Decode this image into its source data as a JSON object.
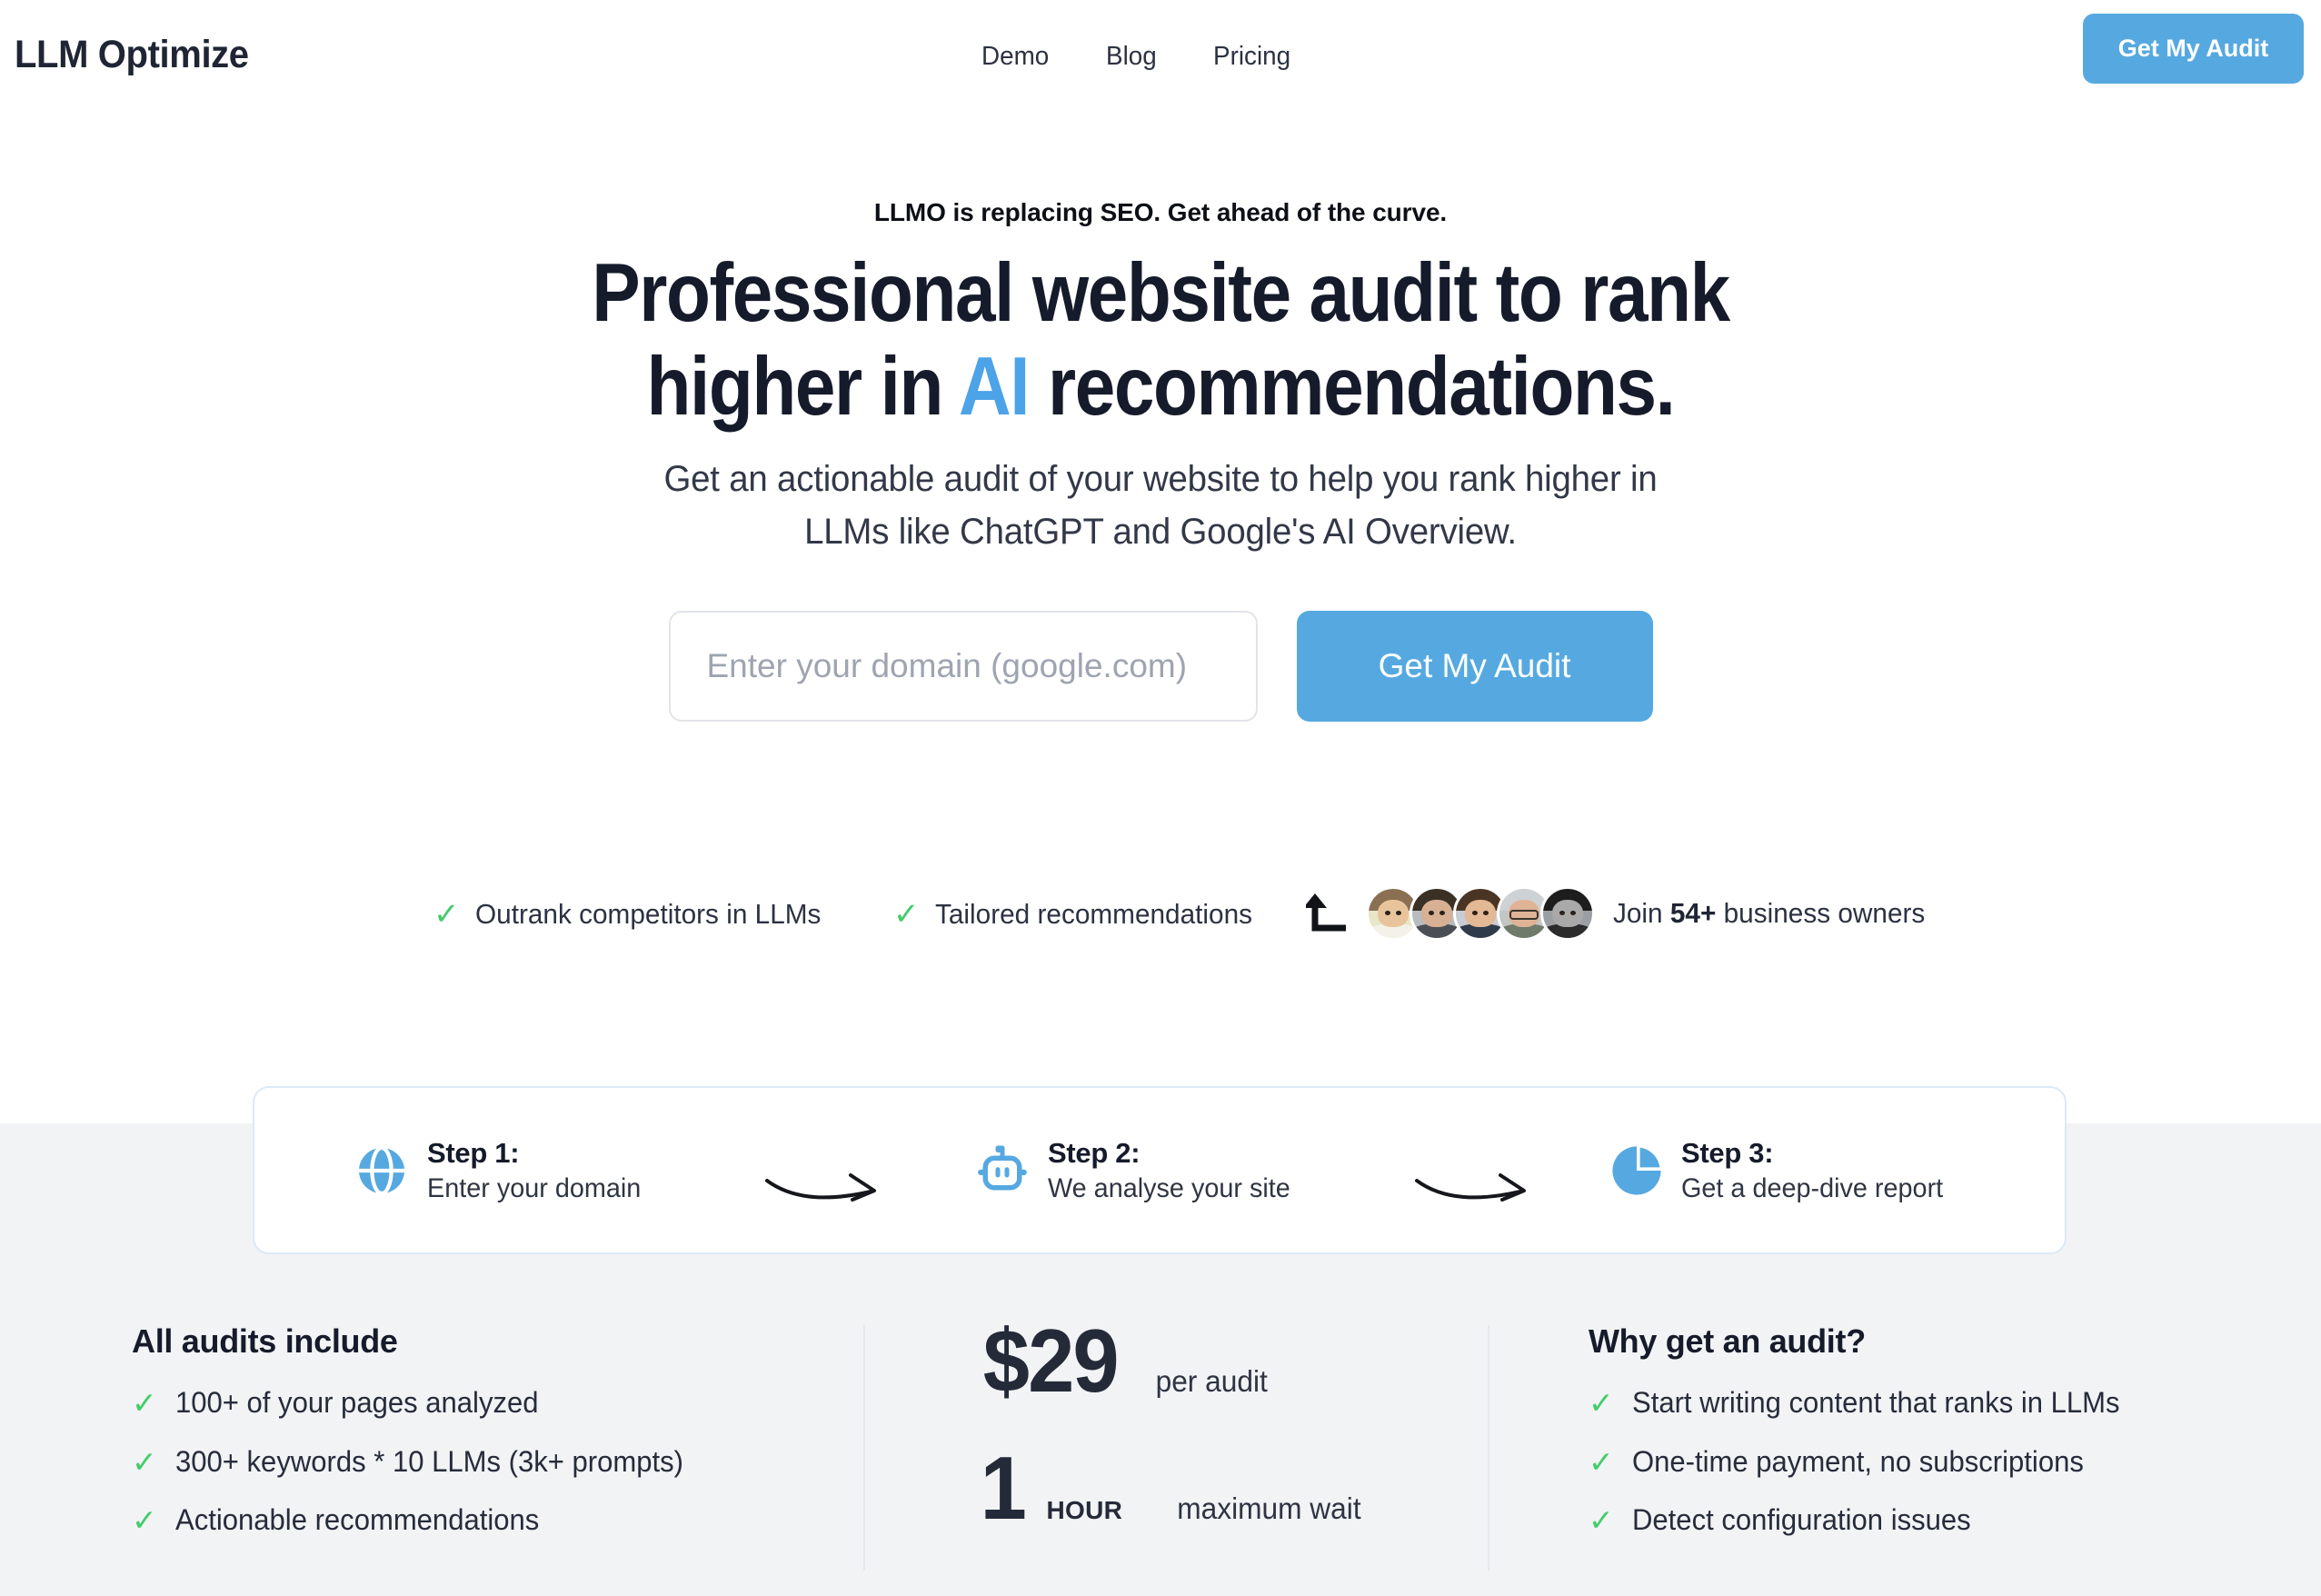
{
  "header": {
    "logo": "LLM Optimize",
    "nav": [
      {
        "label": "Demo"
      },
      {
        "label": "Blog"
      },
      {
        "label": "Pricing"
      }
    ],
    "cta_label": "Get My Audit"
  },
  "hero": {
    "eyebrow": "LLMO is replacing SEO. Get ahead of the curve.",
    "headline_line1": "Professional website audit to rank",
    "headline_line2_before": "higher in ",
    "headline_highlight": "AI",
    "headline_line2_after": " recommendations.",
    "subhead_line1": "Get an actionable audit of your website to help you rank higher in",
    "subhead_line2": "LLMs like ChatGPT and Google's AI Overview.",
    "input_placeholder": "Enter your domain (google.com)",
    "input_value": "",
    "cta_label": "Get My Audit",
    "features": [
      {
        "label": "Outrank competitors in LLMs"
      },
      {
        "label": "Tailored recommendations"
      }
    ],
    "social_proof": {
      "prefix": "Join ",
      "count": "54+",
      "suffix": " business owners",
      "avatar_count": 5
    }
  },
  "steps": [
    {
      "icon": "globe-icon",
      "title": "Step 1:",
      "desc": "Enter your domain"
    },
    {
      "icon": "robot-icon",
      "title": "Step 2:",
      "desc": "We analyse your site"
    },
    {
      "icon": "pie-chart-icon",
      "title": "Step 3:",
      "desc": "Get a deep-dive report"
    }
  ],
  "audits": {
    "title": "All audits include",
    "items": [
      {
        "label": "100+ of your pages analyzed"
      },
      {
        "label": "300+ keywords * 10 LLMs (3k+ prompts)"
      },
      {
        "label": "Actionable recommendations"
      }
    ]
  },
  "pricing": {
    "price": "$29",
    "price_unit": "per audit",
    "wait_number": "1",
    "wait_word": "HOUR",
    "wait_unit": "maximum wait"
  },
  "why": {
    "title": "Why get an audit?",
    "items": [
      {
        "label": "Start writing content that ranks in LLMs"
      },
      {
        "label": "One-time payment, no subscriptions"
      },
      {
        "label": "Detect configuration issues"
      }
    ]
  },
  "colors": {
    "accent_blue": "#56a9e0",
    "headline_navy": "#161b2b",
    "check_green": "#45cc6b",
    "section_gray": "#f1f3f5",
    "card_border": "#dbe9f7"
  },
  "icons": {
    "check": "✓",
    "turn_arrow": "turn-up-arrow-icon"
  }
}
